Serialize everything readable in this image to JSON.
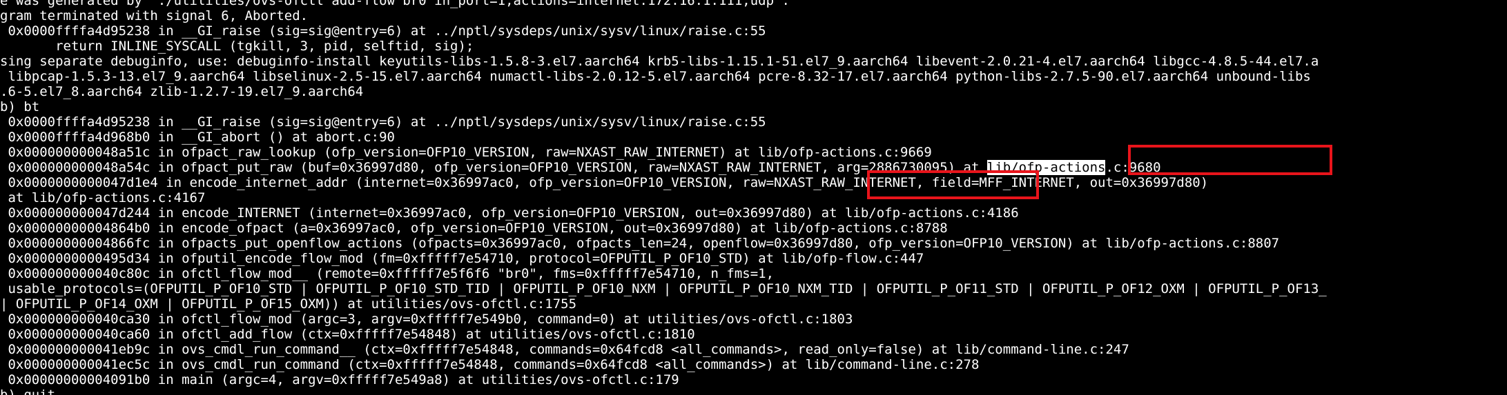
{
  "terminal": {
    "lines": [
      "e was generated by `./utilities/ovs-ofctl add-flow br0 in_port=1,actions=internet:172.16.1.111,udp'.",
      "gram terminated with signal 6, Aborted.",
      " 0x0000ffffa4d95238 in __GI_raise (sig=sig@entry=6) at ../nptl/sysdeps/unix/sysv/linux/raise.c:55",
      "       return INLINE_SYSCALL (tgkill, 3, pid, selftid, sig);",
      "sing separate debuginfo, use: debuginfo-install keyutils-libs-1.5.8-3.el7.aarch64 krb5-libs-1.15.1-51.el7_9.aarch64 libevent-2.0.21-4.el7.aarch64 libgcc-4.8.5-44.el7.a",
      " libpcap-1.5.3-13.el7_9.aarch64 libselinux-2.5-15.el7.aarch64 numactl-libs-2.0.12-5.el7.aarch64 pcre-8.32-17.el7.aarch64 python-libs-2.7.5-90.el7.aarch64 unbound-libs",
      ".6-5.el7_8.aarch64 zlib-1.2.7-19.el7_9.aarch64",
      "b) bt",
      " 0x0000ffffa4d95238 in __GI_raise (sig=sig@entry=6) at ../nptl/sysdeps/unix/sysv/linux/raise.c:55",
      " 0x0000ffffa4d968b0 in __GI_abort () at abort.c:90",
      " 0x000000000048a51c in ofpact_raw_lookup (ofp_version=OFP10_VERSION, raw=NXAST_RAW_INTERNET) at lib/ofp-actions.c:9669",
      null,
      " 0x0000000000047d1e4 in encode_internet_addr (internet=0x36997ac0, ofp_version=OFP10_VERSION, raw=NXAST_RAW_INTERNET, field=MFF_INTERNET, out=0x36997d80)",
      " at lib/ofp-actions.c:4167",
      " 0x000000000047d244 in encode_INTERNET (internet=0x36997ac0, ofp_version=OFP10_VERSION, out=0x36997d80) at lib/ofp-actions.c:4186",
      " 0x00000000004864b0 in encode_ofpact (a=0x36997ac0, ofp_version=OFP10_VERSION, out=0x36997d80) at lib/ofp-actions.c:8788",
      " 0x00000000004866fc in ofpacts_put_openflow_actions (ofpacts=0x36997ac0, ofpacts_len=24, openflow=0x36997d80, ofp_version=OFP10_VERSION) at lib/ofp-actions.c:8807",
      " 0x0000000000495d34 in ofputil_encode_flow_mod (fm=0xfffff7e54710, protocol=OFPUTIL_P_OF10_STD) at lib/ofp-flow.c:447",
      " 0x000000000040c80c in ofctl_flow_mod__ (remote=0xfffff7e5f6f6 \"br0\", fms=0xfffff7e54710, n_fms=1,",
      " usable_protocols=(OFPUTIL_P_OF10_STD | OFPUTIL_P_OF10_STD_TID | OFPUTIL_P_OF10_NXM | OFPUTIL_P_OF10_NXM_TID | OFPUTIL_P_OF11_STD | OFPUTIL_P_OF12_OXM | OFPUTIL_P_OF13_",
      "| OFPUTIL_P_OF14_OXM | OFPUTIL_P_OF15_OXM)) at utilities/ovs-ofctl.c:1755",
      " 0x000000000040ca30 in ofctl_flow_mod (argc=3, argv=0xfffff7e549b0, command=0) at utilities/ovs-ofctl.c:1803",
      " 0x000000000040ca60 in ofctl_add_flow (ctx=0xfffff7e54848) at utilities/ovs-ofctl.c:1810",
      " 0x000000000041eb9c in ovs_cmdl_run_command__ (ctx=0xfffff7e54848, commands=0x64fcd8 <all_commands>, read_only=false) at lib/command-line.c:247",
      " 0x000000000041ec5c in ovs_cmdl_run_command (ctx=0xfffff7e54848, commands=0x64fcd8 <all_commands>) at lib/command-line.c:278",
      " 0x00000000004091b0 in main (argc=4, argv=0xfffff7e549a8) at utilities/ovs-ofctl.c:179",
      "b) quit"
    ],
    "line_11_before": " 0x000000000048a54c in ofpact_put_raw (buf=0x36997d80, ofp_version=OFP10_VERSION, raw=NXAST_RAW_INTERNET, arg=2886730095) at ",
    "line_11_selected": "lib/ofp-actions",
    "line_11_after": ".c:9680",
    "highlight_color": "#e8141b",
    "background_color": "#000000",
    "text_color": "#ffffff"
  }
}
